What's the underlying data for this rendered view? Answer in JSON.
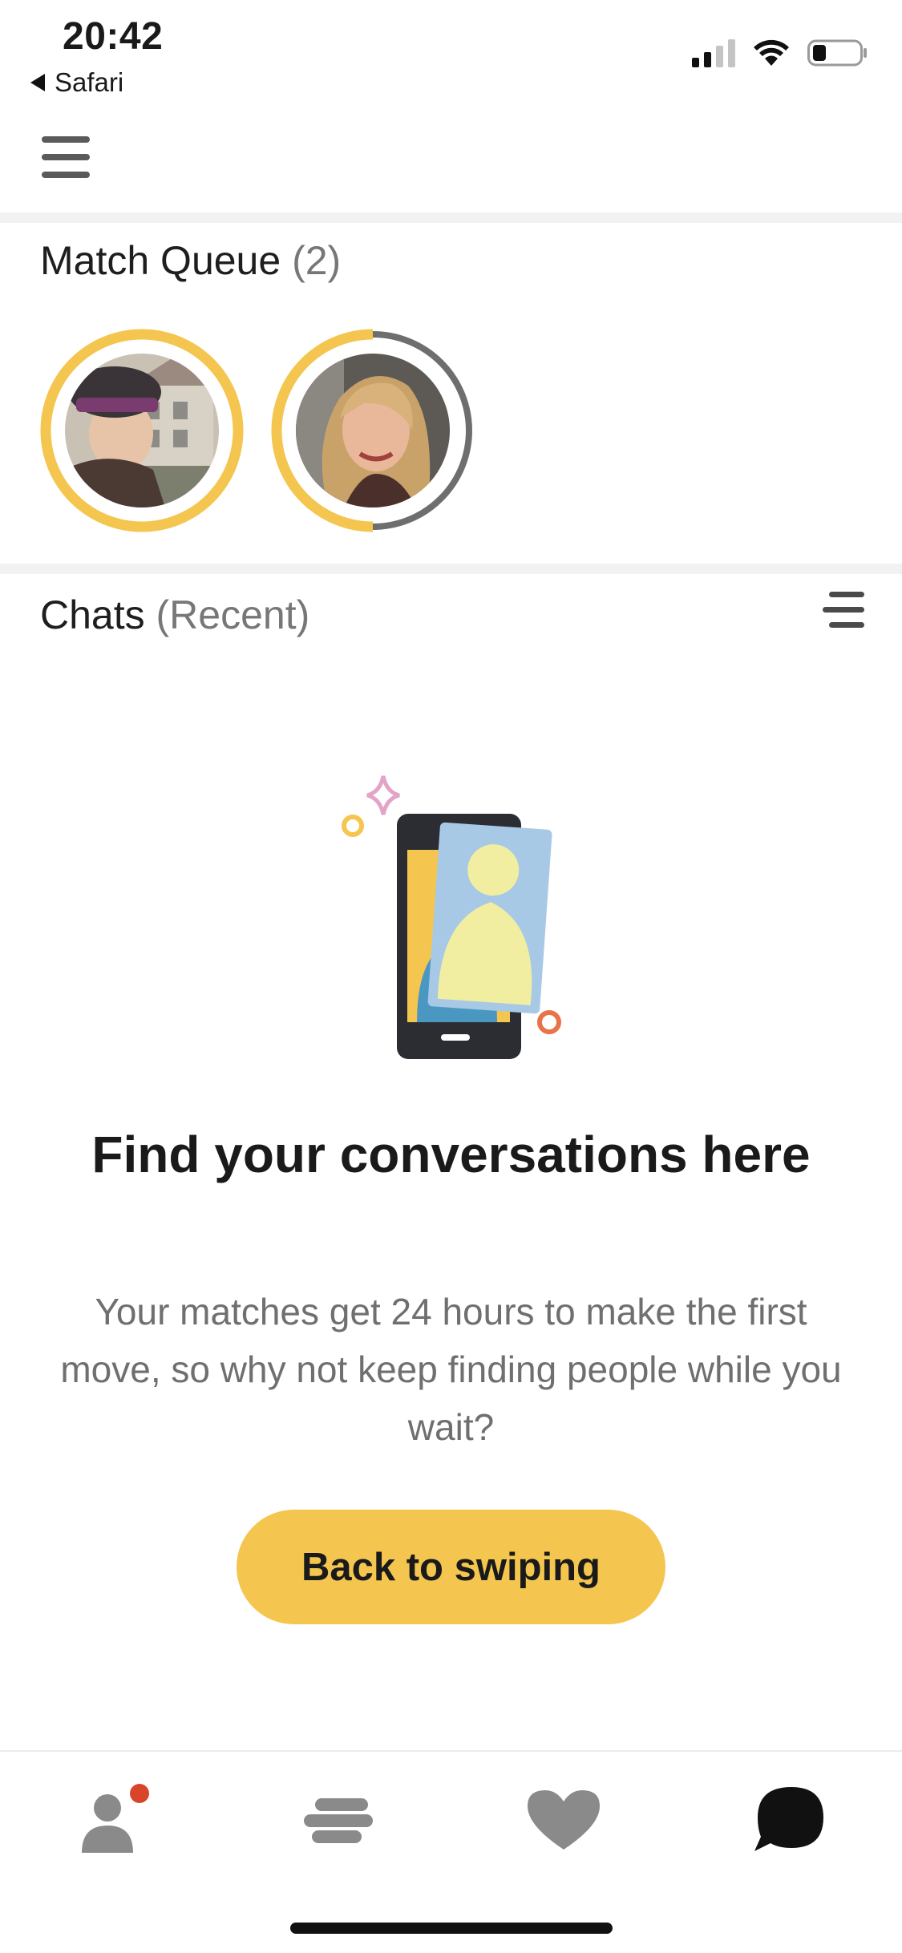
{
  "status_bar": {
    "time": "20:42",
    "back_app": "Safari",
    "signal_bars": 2,
    "battery_level": 0.25
  },
  "header": {
    "menu_icon": "hamburger-menu-icon"
  },
  "match_queue": {
    "title": "Match Queue",
    "count": "(2)",
    "matches": [
      {
        "name": "match-1",
        "time_remaining_fraction": 1.0,
        "ring_color": "#f4c64f"
      },
      {
        "name": "match-2",
        "time_remaining_fraction": 0.5,
        "ring_color": "#f4c64f"
      }
    ]
  },
  "chats": {
    "title": "Chats",
    "subtitle": "(Recent)",
    "sort_icon": "sort-lines-icon"
  },
  "empty_state": {
    "title": "Find your conversations here",
    "text": "Your matches get 24 hours to make the first move, so why not keep finding people while you wait?",
    "button": "Back to swiping"
  },
  "tab_bar": {
    "items": [
      {
        "icon": "profile-icon",
        "badge": true
      },
      {
        "icon": "discover-icon",
        "badge": false
      },
      {
        "icon": "heart-icon",
        "badge": false
      },
      {
        "icon": "chat-bubble-icon",
        "badge": false,
        "active": true
      }
    ]
  },
  "colors": {
    "accent": "#f4c64f",
    "badge": "#d9452b",
    "ring_track": "#6e6e6e",
    "inactive_icon": "#8a8a8a",
    "active_icon": "#111111"
  }
}
